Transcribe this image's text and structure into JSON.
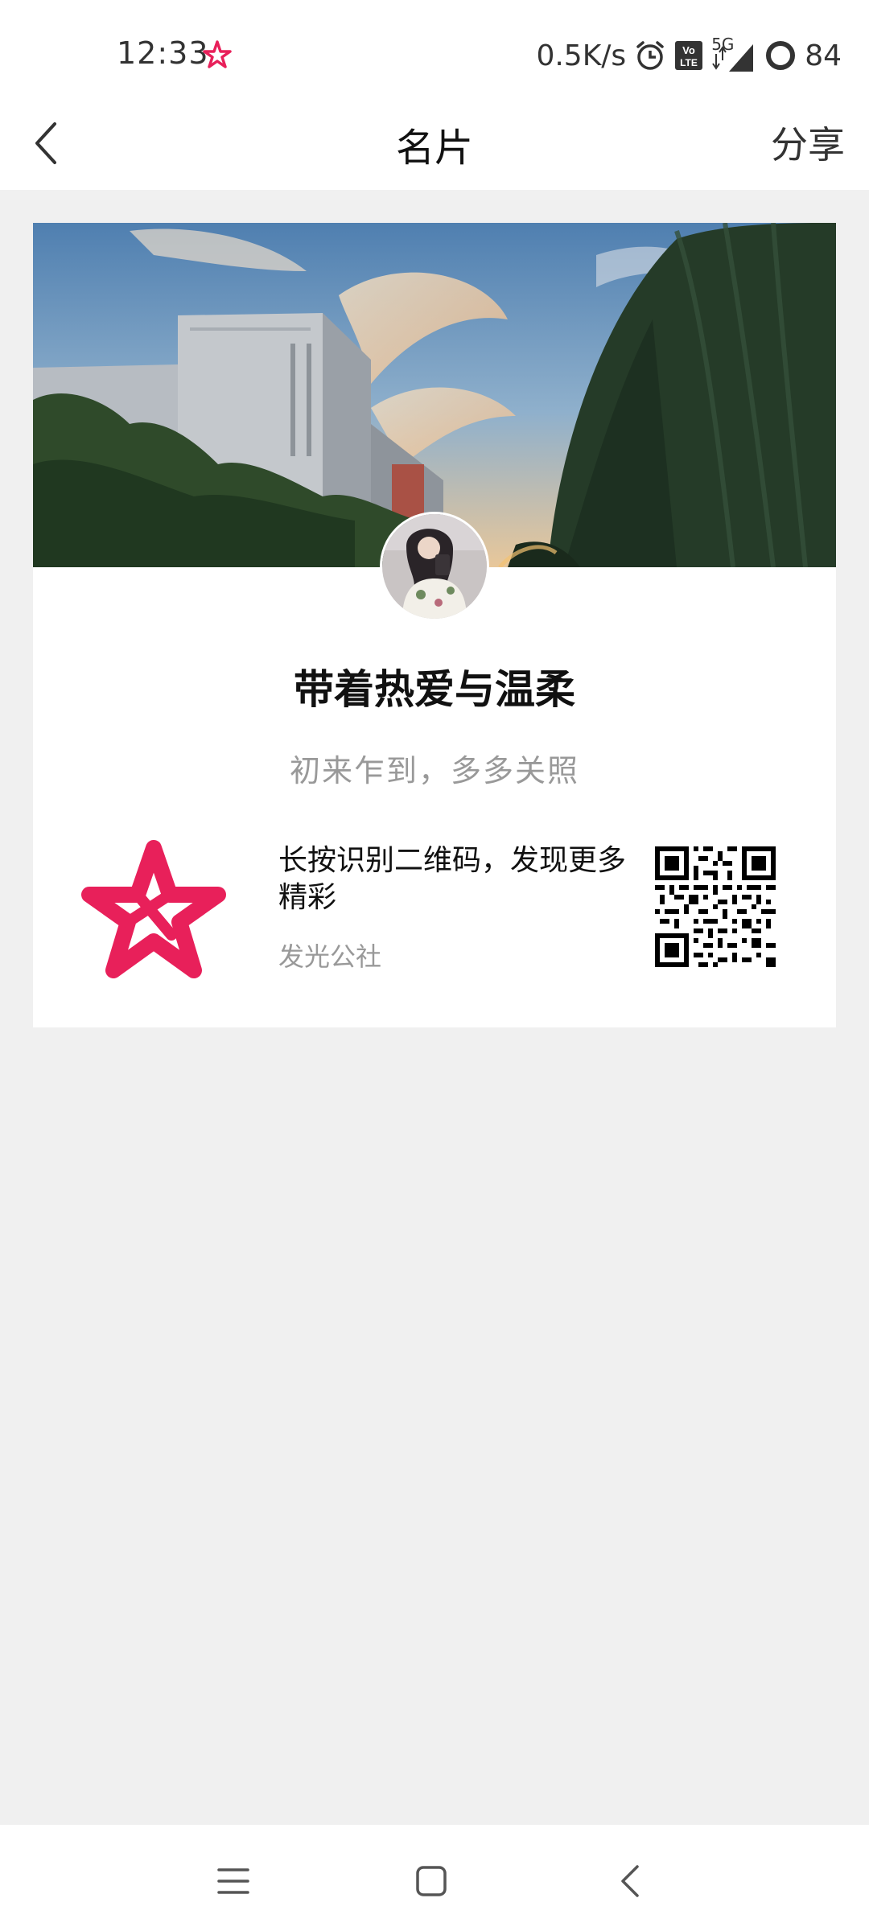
{
  "status_bar": {
    "time": "12:33",
    "network_speed": "0.5K/s",
    "network_type": "5G",
    "volte_label": "Vo LTE",
    "battery": "84",
    "icons": [
      "app-star-icon",
      "alarm-icon",
      "volte-icon",
      "signal-icon",
      "battery-icon"
    ]
  },
  "header": {
    "title": "名片",
    "share_label": "分享",
    "back_icon": "chevron-left-icon"
  },
  "card": {
    "name": "带着热爱与温柔",
    "intro": "初来乍到，多多关照",
    "qr_prompt": "长按识别二维码，发现更多精彩",
    "source": "发光公社",
    "logo_icon": "red-star-logo",
    "cover": "photo of building with sunset sky and willow tree",
    "avatar": "profile photo avatar"
  },
  "nav": {
    "icons": [
      "menu-icon",
      "home-square-icon",
      "back-triangle-icon"
    ]
  },
  "colors": {
    "accent_red": "#e8205a",
    "background": "#f0f0f0",
    "card": "#ffffff",
    "secondary_text": "#999999"
  }
}
